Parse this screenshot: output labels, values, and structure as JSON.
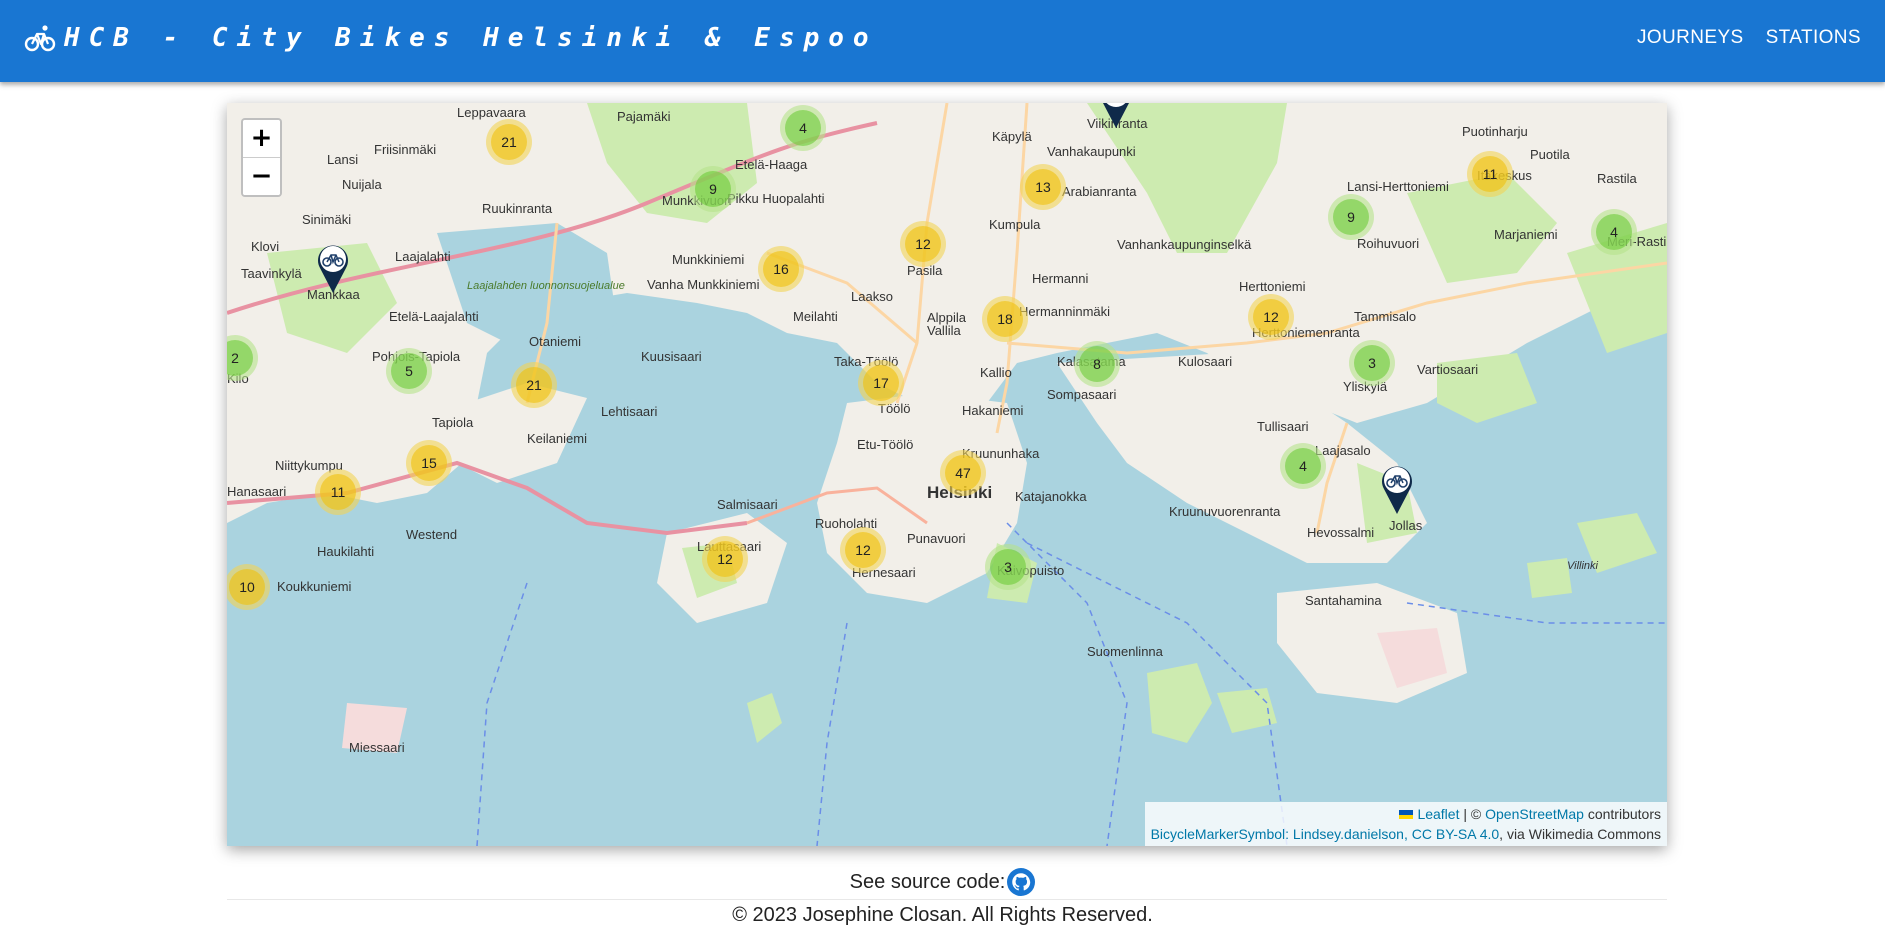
{
  "header": {
    "title": "HCB - City Bikes Helsinki & Espoo",
    "logo_icon": "bicycle-icon",
    "nav": [
      {
        "label": "JOURNEYS"
      },
      {
        "label": "STATIONS"
      }
    ],
    "color": "#1976d2"
  },
  "map": {
    "zoom_in_label": "+",
    "zoom_out_label": "−",
    "water_color": "#aad3df",
    "land_color": "#f2efe9",
    "place_labels": [
      "Leppavaara",
      "Pajamäki",
      "Käpylä",
      "Vanhakaupunki",
      "Viikinranta",
      "Puotinharju",
      "Puotila",
      "Itäkeskus",
      "Rastila",
      "Lansi",
      "Friisinmäki",
      "Nuijala",
      "Sinimäki",
      "Ruukinranta",
      "Etelä-Haaga",
      "Munkkivuori",
      "Arabianranta",
      "Kumpula",
      "Lansi-Herttoniemi",
      "Roihuvuori",
      "Marjaniemi",
      "Meri-Rastila",
      "Klovi",
      "Laajalahti",
      "Taavinkylä",
      "Mankkaa",
      "Pikku Huopalahti",
      "Munkkiniemi",
      "Vanha Munkkiniemi",
      "Pasila",
      "Hermanni",
      "Vanhankaupunginselkä",
      "Laakso",
      "Alppila",
      "Vallila",
      "Hermanninmäki",
      "Etelä-Laajalahti",
      "Meilahti",
      "Herttoniemi",
      "Herttoniemenranta",
      "Tammisalo",
      "Otaniemi",
      "Kuusisaari",
      "Taka-Töölö",
      "Kalasatama",
      "Kulosaari",
      "Yliskylä",
      "Vartiosaari",
      "Pohjois-Tapiola",
      "Tapiola",
      "Kilo",
      "Sompasaari",
      "Kallio",
      "Lehtisaari",
      "Töölö",
      "Hakaniemi",
      "Tullisaari",
      "Laajasalo",
      "Niittykumpu",
      "Keilaniemi",
      "Etu-Töölö",
      "Kruununhaka",
      "Helsinki",
      "Katajanokka",
      "Kruunuvuorenranta",
      "Jollas",
      "Hevossalmi",
      "Salmisaari",
      "Ruoholahti",
      "Punavuori",
      "Kaivopuisto",
      "Villinki",
      "Hanasaari",
      "Westend",
      "Haukilahti",
      "Lauttasaari",
      "Hernesaari",
      "Santahamina",
      "Koukkuniemi",
      "Suomenlinna",
      "Miessaari",
      "Laajalahden luonnonsuojelualue"
    ],
    "clusters": [
      {
        "count": "21",
        "level": "med"
      },
      {
        "count": "4",
        "level": "small"
      },
      {
        "count": "9",
        "level": "small"
      },
      {
        "count": "13",
        "level": "med"
      },
      {
        "count": "11",
        "level": "med"
      },
      {
        "count": "9",
        "level": "small"
      },
      {
        "count": "4",
        "level": "small"
      },
      {
        "count": "16",
        "level": "med"
      },
      {
        "count": "12",
        "level": "med"
      },
      {
        "count": "18",
        "level": "med"
      },
      {
        "count": "12",
        "level": "med"
      },
      {
        "count": "2",
        "level": "small"
      },
      {
        "count": "5",
        "level": "small"
      },
      {
        "count": "21",
        "level": "med"
      },
      {
        "count": "17",
        "level": "med"
      },
      {
        "count": "8",
        "level": "small"
      },
      {
        "count": "3",
        "level": "small"
      },
      {
        "count": "15",
        "level": "med"
      },
      {
        "count": "11",
        "level": "med"
      },
      {
        "count": "47",
        "level": "med"
      },
      {
        "count": "4",
        "level": "small"
      },
      {
        "count": "12",
        "level": "med"
      },
      {
        "count": "12",
        "level": "med"
      },
      {
        "count": "3",
        "level": "small"
      },
      {
        "count": "10",
        "level": "med"
      }
    ],
    "markers": [
      {
        "icon": "bike-station-marker-icon"
      },
      {
        "icon": "bike-station-marker-icon"
      },
      {
        "icon": "bike-station-marker-icon"
      }
    ],
    "attribution": {
      "leaflet": "Leaflet",
      "sep1": " | © ",
      "osm": "OpenStreetMap",
      "contributors": " contributors",
      "symbol": "BicycleMarkerSymbol: Lindsey.danielson, CC BY-SA 4.0",
      "via": ", via Wikimedia Commons"
    }
  },
  "footer": {
    "source_label": "See source code:",
    "github_icon": "github-icon",
    "copyright": "© 2023 Josephine Closan. All Rights Reserved."
  }
}
